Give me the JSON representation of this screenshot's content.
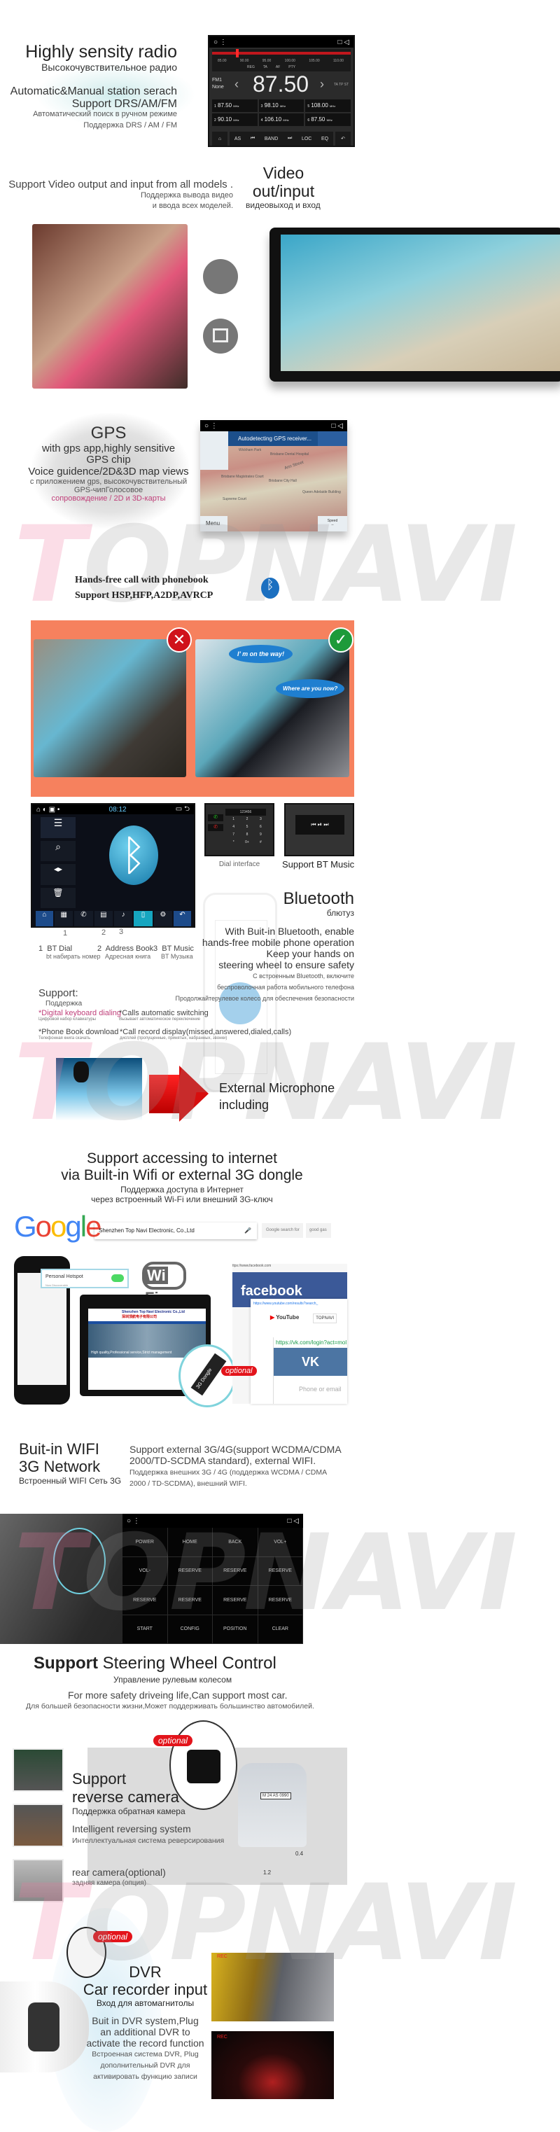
{
  "watermark": "TOPNAVI",
  "radio": {
    "title": "Highly sensity radio",
    "title_ru": "Высокочувствительное радио",
    "line1": "Automatic&Manual station serach",
    "line2": "Support DRS/AM/FM",
    "line1_ru": "Автоматический поиск в ручном режиме",
    "line2_ru": "Поддержка DRS / AM / FM",
    "scale": [
      "85.00",
      "90.00",
      "95.00",
      "100.00",
      "105.00",
      "110.00"
    ],
    "options": [
      "REG",
      "TA",
      "AF",
      "PTY"
    ],
    "band": "FM1",
    "station": "None",
    "frequency": "87.50",
    "flags": "TA TP ST",
    "presets": [
      {
        "n": "1",
        "f": "87.50"
      },
      {
        "n": "3",
        "f": "98.10"
      },
      {
        "n": "5",
        "f": "108.00"
      },
      {
        "n": "2",
        "f": "90.10"
      },
      {
        "n": "4",
        "f": "106.10"
      },
      {
        "n": "6",
        "f": "87.50"
      }
    ],
    "unit": "MHz",
    "buttons": [
      "AS",
      "BAND",
      "LOC",
      "EQ"
    ]
  },
  "video": {
    "desc": "Support Video output and input from all models .",
    "desc_ru1": "Поддержка вывода видео",
    "desc_ru2": "и ввода всех моделей.",
    "title1": "Video",
    "title2": "out/input",
    "title_ru": "видеовыход и вход"
  },
  "gps": {
    "title": "GPS",
    "l1": "with gps app,highly sensitive",
    "l2": "GPS chip",
    "l3": "Voice guidence/2D&3D map views",
    "ru1": "с приложением gps, высокочувствительный",
    "ru2": "GPS-чипГолосовое",
    "ru3": "сопровождение / 2D и 3D-карты",
    "banner": "Autodetecting GPS receiver...",
    "menu": "Menu",
    "speed": "Speed",
    "speed_val": "--",
    "places": [
      "Wickham Park",
      "Brisbane Dental Hospital",
      "Ann Street",
      "Brisbane Magistrates Court",
      "Brisbane City Hall",
      "Queen Adelaide Building",
      "Supreme Court"
    ]
  },
  "handsfree": {
    "l1": "Hands-free call with phonebook",
    "l2": "Support HSP,HFP,A2DP,AVRCP",
    "bubble1": "I’ m on the way!",
    "bubble2": "Where are you now?"
  },
  "bt": {
    "clock": "08:12",
    "dial_number": "123456",
    "keys": [
      "1",
      "2",
      "3",
      "4",
      "5",
      "6",
      "7",
      "8",
      "9",
      "*",
      "0+",
      "#"
    ],
    "dial_label": "Dial interface",
    "music_label": "Support BT Music",
    "nums": [
      "1",
      "2",
      "3"
    ],
    "items": [
      {
        "n": "1",
        "en": "BT Dial",
        "ru": "bt набирать номер"
      },
      {
        "n": "2",
        "en": "Address Book",
        "ru": "Адресная книга"
      },
      {
        "n": "3",
        "en": "BT Music",
        "ru": "BT Музыка"
      }
    ],
    "title": "Bluetooth",
    "title_ru": "блютуз",
    "desc": [
      "With Buit-in Bluetooth, enable",
      "hands-free mobile phone operation",
      "Keep your hands on",
      "steering wheel to ensure safety"
    ],
    "desc_ru": [
      "С встроенным Bluetooth, включите",
      "беспроволочная работа мобильного телефона",
      "Продолжайтерулевое колесо для обеспечения безопасности"
    ],
    "support": "Support:",
    "support_ru": "Поддержка",
    "features": [
      {
        "en": "*Digital keyboard dialing",
        "ru": "Цифровой набор клавиатуры"
      },
      {
        "en": "*Calls automatic switching",
        "ru": "Вызывает автоматическое переключение"
      },
      {
        "en": "*Phone Book download",
        "ru": "Телефонная книга скачать"
      },
      {
        "en": "*Call record display(missed,answered,dialed,calls)",
        "ru": "дисплей (пропущенные, принятых, набранных, звонки)"
      }
    ]
  },
  "mic": {
    "l1": "External Microphone",
    "l2": "including"
  },
  "internet": {
    "l1": "Support accessing  to internet",
    "l2": "via Built-in Wifi or external 3G dongle",
    "ru1": "Поддержка доступа в Интернет",
    "ru2": "через встроенный Wi-Fi или внешний 3G-ключ",
    "google": "Google",
    "search_value": "Shenzhen Top Navi Electronic, Co.,Ltd",
    "btn1": "Google search for",
    "btn2": "good gas",
    "hotspot": "Personal Hotspot",
    "hotspot_sub": "Now Discoverable",
    "wifi_logo_a": "Wi",
    "wifi_logo_b": "Fi",
    "site_title": "Shenzhen Top Navi Electronic Co.,Ltd",
    "site_title_cn": "深圳顶航电子有限公司",
    "site_slogan": "High quality,Professional service,Strict management",
    "dongle": "3G Dongle",
    "optional": "optional",
    "fb_url": "ttps://www.facebook.com",
    "facebook": "facebook",
    "yt_url": "https://www.youtube.com/results?search_",
    "youtube": "YouTube",
    "yt_search": "TOPNAVI",
    "vk_url": "https://vk.com/login?act=mol",
    "vk": "VK",
    "vk_field": "Phone or email"
  },
  "wifi": {
    "t1": "Buit-in WIFI",
    "t2": "3G Network",
    "t_ru": "Встроенный WIFI Сеть 3G",
    "d1": "Support external 3G/4G(support WCDMA/CDMA",
    "d2": "2000/TD-SCDMA standard), external WIFI.",
    "ru1": "Поддержка внешних 3G / 4G (поддержка WCDMA / CDMA",
    "ru2": "2000 / TD-SCDMA), внешний WIFI."
  },
  "swc": {
    "keys": [
      "POWER",
      "HOME",
      "BACK",
      "VOL+",
      "VOL-",
      "RESERVE",
      "RESERVE",
      "RESERVE",
      "RESERVE",
      "RESERVE",
      "RESERVE",
      "RESERVE",
      "START",
      "CONFIG",
      "POSITION",
      "CLEAR"
    ],
    "title_a": "Support",
    "title_b": "Steering Wheel Control",
    "title_ru": "Управление рулевым колесом",
    "d": "For more safety driveing life,Can support most car.",
    "d_ru": "Для большей безопасности жизни,Может поддерживать большинство автомобилей."
  },
  "reverse": {
    "optional": "optional",
    "t1": "Support",
    "t2": "reverse camera",
    "t_ru": "Поддержка обратная камера",
    "s1": "Intelligent reversing system",
    "s1_ru": "Интеллектуальная система реверсирования",
    "s2": "rear camera(optional)",
    "s2_ru": "задняя камера (опция)",
    "plate": "M 24 AS 0990",
    "dist1": "0.4",
    "dist2": "1.2"
  },
  "dvr": {
    "optional": "optional",
    "t1": "DVR",
    "t2": "Car recorder input",
    "t_ru": "Вход для автомагнитолы",
    "d": [
      "Buit in DVR system,Plug",
      "an additional DVR to",
      "activate the record function"
    ],
    "d_ru": [
      "Встроенная система DVR, Plug",
      "дополнительный DVR для",
      "активировать функцию записи"
    ],
    "rec": "REC"
  },
  "colors": {
    "accent_red": "#e3141b",
    "orange_panel": "#f6815e",
    "bt_blue": "#1b8fd6",
    "wm_pink": "#f07aa0",
    "google_blue": "#4285f4",
    "fb_blue": "#3b5998"
  }
}
